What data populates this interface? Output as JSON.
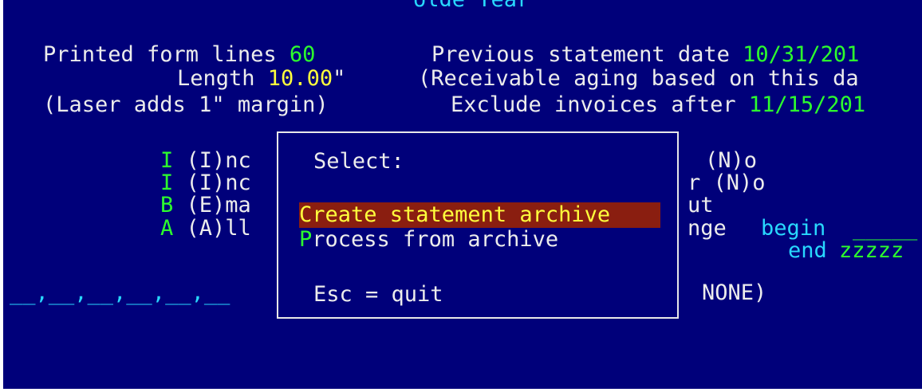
{
  "colors": {
    "background": "#00007a",
    "text": "#ececec",
    "value_green": "#2dff2d",
    "value_yellow": "#ffff3c",
    "accent_cyan": "#28d8ff",
    "selection_bg": "#8a1e10",
    "dialog_border": "#e8e8e8"
  },
  "top_fragment": "olde Year",
  "left_panel": {
    "form_lines_label": "Printed form lines ",
    "form_lines_value": "60",
    "length_label": "Length ",
    "length_value": "10.00",
    "length_suffix": "\"",
    "laser_note": "(Laser adds 1\" margin)"
  },
  "right_panel": {
    "prev_date_label": "Previous statement date ",
    "prev_date_value": "10/31/201",
    "aging_note": "(Receivable aging based on this da",
    "exclude_label": "Exclude invoices after ",
    "exclude_value": "11/15/201"
  },
  "options": [
    {
      "code": "I",
      "text": " (I)nc"
    },
    {
      "code": "I",
      "text": " (I)nc"
    },
    {
      "code": "B",
      "text": " (E)ma"
    },
    {
      "code": "A",
      "text": " (A)ll"
    }
  ],
  "right_fragments": {
    "row1": "(N)o",
    "row2": "r (N)o",
    "row3": "ut",
    "row4_label": "nge",
    "row4_begin_label": "begin",
    "row4_begin_value": "_____",
    "row5_end_label": "end",
    "row5_end_value": "zzzzz",
    "row6": "NONE)"
  },
  "left_blanks": "__,__,__,__,__,__",
  "dialog": {
    "title": "Select:",
    "items": [
      {
        "label": "Create statement archive",
        "selected": true
      },
      {
        "hotkey": "P",
        "rest": "rocess from archive",
        "selected": false
      }
    ],
    "footer": "Esc = quit"
  }
}
